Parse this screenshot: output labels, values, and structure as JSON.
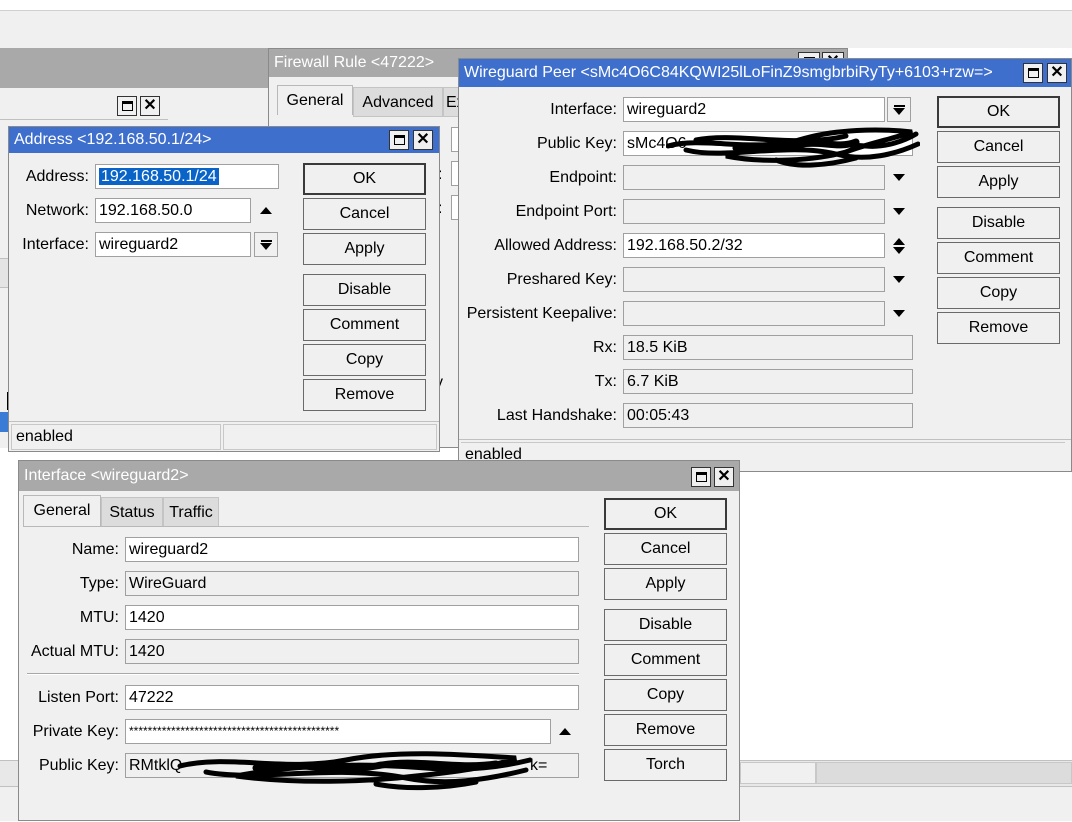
{
  "firewall": {
    "title": "Firewall Rule <47222>",
    "tabs": [
      "General",
      "Advanced",
      "Ex"
    ]
  },
  "address": {
    "title": "Address <192.168.50.1/24>",
    "fields": {
      "address_label": "Address:",
      "address_value": "192.168.50.1/24",
      "network_label": "Network:",
      "network_value": "192.168.50.0",
      "interface_label": "Interface:",
      "interface_value": "wireguard2"
    },
    "buttons": [
      "OK",
      "Cancel",
      "Apply",
      "Disable",
      "Comment",
      "Copy",
      "Remove"
    ],
    "status": "enabled"
  },
  "peer": {
    "title": "Wireguard Peer <sMc4O6C84KQWI25lLoFinZ9smgbrbiRyTy+6103+rzw=>",
    "labels": {
      "interface": "Interface:",
      "public_key": "Public Key:",
      "endpoint": "Endpoint:",
      "endpoint_port": "Endpoint Port:",
      "allowed_address": "Allowed Address:",
      "preshared_key": "Preshared Key:",
      "persistent_keepalive": "Persistent Keepalive:",
      "rx": "Rx:",
      "tx": "Tx:",
      "last_handshake": "Last Handshake:"
    },
    "values": {
      "interface": "wireguard2",
      "public_key": "sMc4O6",
      "endpoint": "",
      "endpoint_port": "",
      "allowed_address": "192.168.50.2/32",
      "preshared_key": "",
      "persistent_keepalive": "",
      "rx": "18.5 KiB",
      "tx": "6.7 KiB",
      "last_handshake": "00:05:43"
    },
    "buttons": [
      "OK",
      "Cancel",
      "Apply",
      "Disable",
      "Comment",
      "Copy",
      "Remove"
    ],
    "status": "enabled"
  },
  "iface": {
    "title": "Interface <wireguard2>",
    "tabs": [
      "General",
      "Status",
      "Traffic"
    ],
    "labels": {
      "name": "Name:",
      "type": "Type:",
      "mtu": "MTU:",
      "actual_mtu": "Actual MTU:",
      "listen_port": "Listen Port:",
      "private_key": "Private Key:",
      "public_key": "Public Key:"
    },
    "values": {
      "name": "wireguard2",
      "type": "WireGuard",
      "mtu": "1420",
      "actual_mtu": "1420",
      "listen_port": "47222",
      "private_key": "*********************************************",
      "public_key": "RMtklQ",
      "public_key_tail": "k="
    },
    "buttons": [
      "OK",
      "Cancel",
      "Apply",
      "Disable",
      "Comment",
      "Copy",
      "Remove",
      "Torch"
    ]
  },
  "background": {
    "partial_y": "y"
  }
}
